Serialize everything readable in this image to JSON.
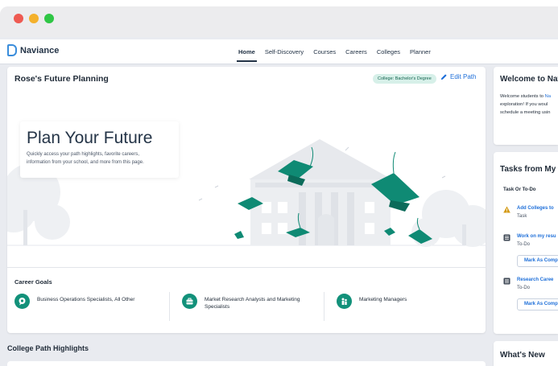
{
  "app": {
    "logo_text": "Naviance",
    "nav": [
      {
        "label": "Home",
        "active": true
      },
      {
        "label": "Self-Discovery"
      },
      {
        "label": "Courses"
      },
      {
        "label": "Careers"
      },
      {
        "label": "Colleges"
      },
      {
        "label": "Planner"
      }
    ]
  },
  "future_planning": {
    "title": "Rose's Future Planning",
    "badge": "College: Bachelor's Degree",
    "edit_label": "Edit Path",
    "hero_title": "Plan Your Future",
    "hero_subtitle_line1": "Quickly access your path highlights, favorite careers,",
    "hero_subtitle_line2": "information from your school, and more from this page."
  },
  "career_goals": {
    "title": "Career Goals",
    "items": [
      {
        "label_line1": "Business Operations Specialists, All Other",
        "label_line2": "",
        "icon": "chat-bubble-icon"
      },
      {
        "label_line1": "Market Research Analysts and Marketing",
        "label_line2": "Specialists",
        "icon": "briefcase-icon"
      },
      {
        "label_line1": "Marketing Managers",
        "label_line2": "",
        "icon": "people-icon"
      }
    ]
  },
  "college_path": {
    "title": "College Path Highlights"
  },
  "welcome": {
    "title": "Welcome to Nav",
    "line1_prefix": "Welcome students to ",
    "line1_link": "Na",
    "line2": "exploration! If you woul",
    "line3": "schedule a meeting usin"
  },
  "tasks": {
    "title": "Tasks from My S",
    "header": "Task Or To-Do",
    "items": [
      {
        "name": "Add Colleges to",
        "type": "Task",
        "icon": "warning-icon",
        "button": ""
      },
      {
        "name": "Work on my resu",
        "type": "To-Do",
        "icon": "checklist-icon",
        "button": "Mark As Comp"
      },
      {
        "name": "Research Caree",
        "type": "To-Do",
        "icon": "checklist-icon",
        "button": "Mark As Comp"
      }
    ]
  },
  "whats_new": {
    "title": "What's New"
  },
  "colors": {
    "accent_teal": "#12917a",
    "link_blue": "#1e6fd9",
    "badge_bg": "#d7f0e9",
    "page_bg": "#e9ebf0"
  }
}
